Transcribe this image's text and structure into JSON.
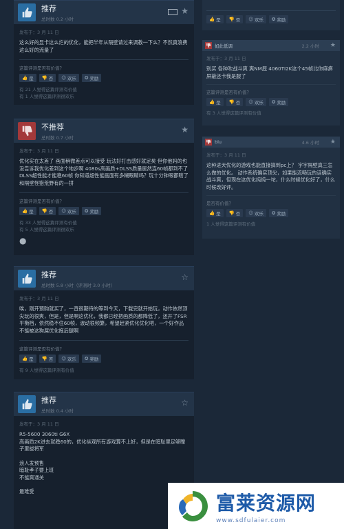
{
  "reviews": [
    {
      "title": "推荐",
      "hours": "总时数 0.2 小时",
      "posted": "发布于：3 月 11 日",
      "text": "这么好的显卡这么烂的优化，能把半年从隔壁请过来调教一下么？不然真浪费这么好的流量了",
      "ask": "这篇评测是否有价值？",
      "yes": "是",
      "no": "否",
      "funny": "欢乐",
      "award": "奖励",
      "stat1": "有 21 人觉得这篇评测有价值",
      "stat2": "有 1 人觉得这篇评测很欢乐"
    },
    {
      "title": "不推荐",
      "hours": "总时数 0.7 小时",
      "posted": "发布于：3 月 11 日",
      "text": "优化实在太差了 画面稍微差点可以接受 玩法好打击感好就足矣 但你他妈的也没告诉我优化差到这个地步啊 4080s高画质+DLSS质量居然连60帧都到不了 DLSS超性能才能稳60帧 你知道超性能画面有多糊眼睛吗？玩十分钟眼都瞎了 和隔壁怪猎荒野有的一拼",
      "ask": "这篇评测是否有价值？",
      "yes": "是",
      "no": "否",
      "funny": "欢乐",
      "award": "奖励",
      "stat1": "有 33 人觉得这篇评测有价值",
      "stat2": "有 5 人觉得这篇评测很欢乐"
    },
    {
      "title": "推荐",
      "hours": "总时数 5.8 小时（评测时 3.0 小时）",
      "posted": "发布于：3 月 11 日",
      "text": "唉，刚开预购就买了，一直很期待的等到今天，下载完就开始玩，动作依然顶尖玩的很爽，但是，但是啊这优化，我都已经把画质的都降低了，还开了FSR平衡档，依然稳不住60帧，波动很频繁，希望赶紧优化优化吧，一个好作品不能被这狗屎优化拖后腿啊",
      "ask": "这篇评测是否有价值？",
      "yes": "是",
      "no": "否",
      "funny": "欢乐",
      "award": "奖励",
      "stat1": "有 9 人觉得这篇评测有价值"
    },
    {
      "title": "推荐",
      "hours": "总时数 0.4 小时",
      "posted": "发布于：3 月 11 日",
      "lines": [
        "R5-5600 3060ti G6X",
        "高画质2K进去就稳60的，优化纵观所有游戏算不上好，但是在暗耻里足够瞳子里拔将军",
        "",
        "浪人发预售",
        "暗耻孝子要上班",
        "不能爽通关",
        "",
        "最难受"
      ]
    }
  ],
  "side": [
    {
      "yes": "是",
      "no": "否",
      "funny": "欢乐",
      "award": "奖励"
    },
    {
      "name": "如此低调",
      "hours": "2.2 小时",
      "posted": "发布于：3 月 11 日",
      "text": "别买 各种吹战斗爽 爽NM屁 4060TI2K这个45帧比你麻痹屏蔽还卡我是服了",
      "ask": "这篇评测是否有价值？",
      "yes": "是",
      "no": "否",
      "funny": "欢乐",
      "award": "奖励",
      "stat": "有 3 人觉得这篇评测有价值"
    },
    {
      "name": "blu",
      "hours": "4.6 小时",
      "posted": "发布于：3 月 11 日",
      "text": "这种进天优化的游戏也能直接搞到pc上？ 字字隔壁真三怎么做的优化。 动作系统确实顶尖，如果能流畅玩的话确实战斗爽，但现在这优化纯纯一坨，什么时候优化好了，什么时候改好评。",
      "ask": "是否有价值？",
      "yes": "是",
      "no": "否",
      "funny": "欢乐",
      "award": "奖励",
      "stat": "1 人觉得这篇评测有价值"
    }
  ],
  "watermark": {
    "title": "富莱资源网",
    "url": "www.sdfulaier.com"
  },
  "colors": {
    "background": "#1b2838",
    "thumb_up": "#2a6ea3",
    "thumb_down": "#a3393a"
  }
}
